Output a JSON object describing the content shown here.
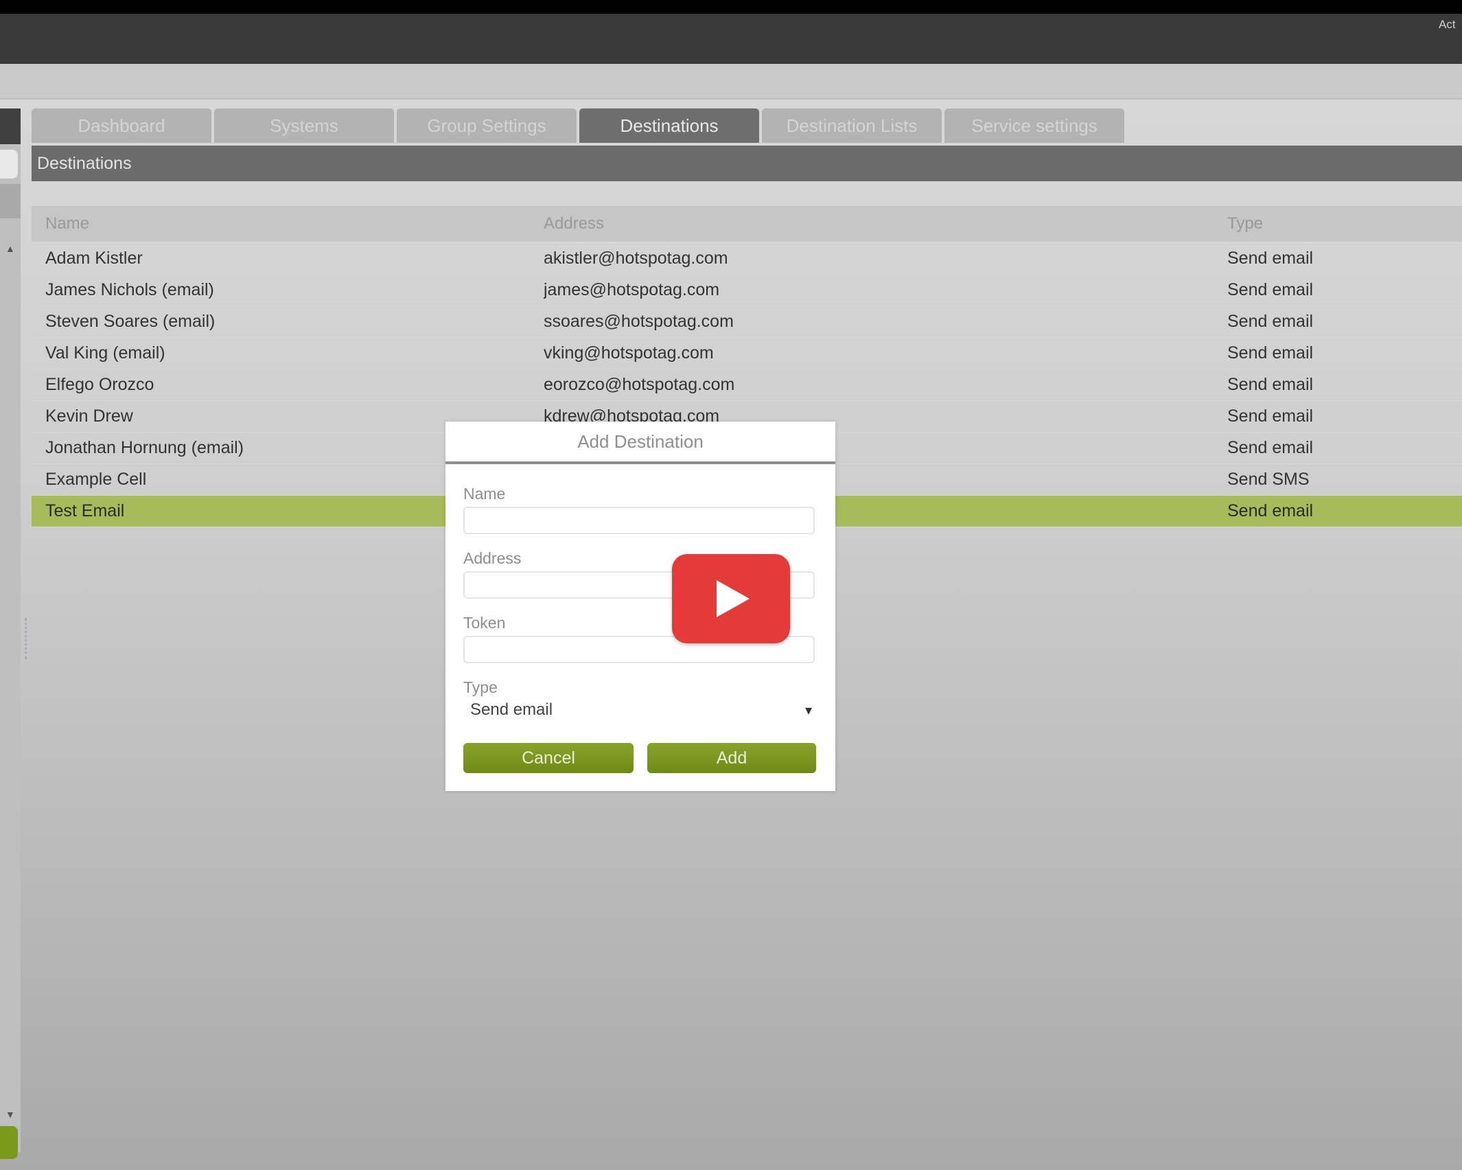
{
  "app": {
    "top_right_text": "Act"
  },
  "tabs": [
    {
      "label": "Dashboard",
      "active": false
    },
    {
      "label": "Systems",
      "active": false
    },
    {
      "label": "Group Settings",
      "active": false
    },
    {
      "label": "Destinations",
      "active": true
    },
    {
      "label": "Destination Lists",
      "active": false
    },
    {
      "label": "Service settings",
      "active": false
    }
  ],
  "section": {
    "title": "Destinations"
  },
  "table": {
    "columns": [
      "Name",
      "Address",
      "Type"
    ],
    "rows": [
      {
        "name": "Adam Kistler",
        "address": "akistler@hotspotag.com",
        "type": "Send email"
      },
      {
        "name": "James Nichols (email)",
        "address": "james@hotspotag.com",
        "type": "Send email"
      },
      {
        "name": "Steven Soares (email)",
        "address": "ssoares@hotspotag.com",
        "type": "Send email"
      },
      {
        "name": "Val King (email)",
        "address": "vking@hotspotag.com",
        "type": "Send email"
      },
      {
        "name": "Elfego Orozco",
        "address": "eorozco@hotspotag.com",
        "type": "Send email"
      },
      {
        "name": "Kevin Drew",
        "address": "kdrew@hotspotag.com",
        "type": "Send email"
      },
      {
        "name": "Jonathan Hornung (email)",
        "address": "",
        "type": "Send email"
      },
      {
        "name": "Example Cell",
        "address": "",
        "type": "Send SMS"
      },
      {
        "name": "Test Email",
        "address": "",
        "type": "Send email",
        "selected": true
      }
    ]
  },
  "modal": {
    "title": "Add Destination",
    "name_label": "Name",
    "name_value": "",
    "address_label": "Address",
    "address_value": "",
    "token_label": "Token",
    "token_value": "",
    "type_label": "Type",
    "type_selected": "Send email",
    "cancel_label": "Cancel",
    "add_label": "Add"
  },
  "colors": {
    "accent_green": "#7b9a1c",
    "selected_row": "#a8bb5a",
    "play_red": "#e33a3a"
  },
  "icons": {
    "play": "play-icon",
    "chevron": "chevron-down-icon"
  }
}
